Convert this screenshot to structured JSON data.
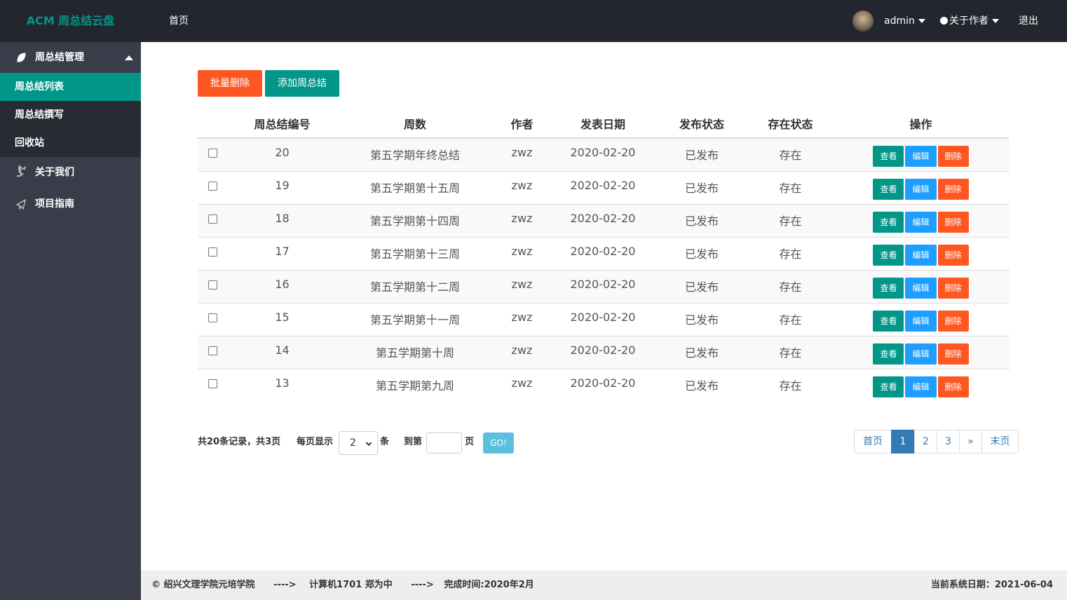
{
  "header": {
    "logo": "ACM 周总结云盘",
    "nav_home": "首页",
    "user": "admin",
    "about_author": "关于作者",
    "logout": "退出"
  },
  "sidebar": {
    "group_label": "周总结管理",
    "sub_items": [
      {
        "label": "周总结列表",
        "active": true
      },
      {
        "label": "周总结撰写",
        "active": false
      },
      {
        "label": "回收站",
        "active": false
      }
    ],
    "links": [
      {
        "label": "关于我们",
        "icon": "twitter-icon"
      },
      {
        "label": "项目指南",
        "icon": "paper-plane-icon"
      }
    ]
  },
  "toolbar": {
    "batch_delete": "批量删除",
    "add_summary": "添加周总结"
  },
  "table": {
    "headers": [
      "周总结编号",
      "周数",
      "作者",
      "发表日期",
      "发布状态",
      "存在状态",
      "操作"
    ],
    "actions": {
      "view": "查看",
      "edit": "编辑",
      "delete": "删除"
    },
    "rows": [
      {
        "id": "20",
        "week": "第五学期年终总结",
        "author": "zwz",
        "date": "2020-02-20",
        "publish": "已发布",
        "exist": "存在"
      },
      {
        "id": "19",
        "week": "第五学期第十五周",
        "author": "zwz",
        "date": "2020-02-20",
        "publish": "已发布",
        "exist": "存在"
      },
      {
        "id": "18",
        "week": "第五学期第十四周",
        "author": "zwz",
        "date": "2020-02-20",
        "publish": "已发布",
        "exist": "存在"
      },
      {
        "id": "17",
        "week": "第五学期第十三周",
        "author": "zwz",
        "date": "2020-02-20",
        "publish": "已发布",
        "exist": "存在"
      },
      {
        "id": "16",
        "week": "第五学期第十二周",
        "author": "zwz",
        "date": "2020-02-20",
        "publish": "已发布",
        "exist": "存在"
      },
      {
        "id": "15",
        "week": "第五学期第十一周",
        "author": "zwz",
        "date": "2020-02-20",
        "publish": "已发布",
        "exist": "存在"
      },
      {
        "id": "14",
        "week": "第五学期第十周",
        "author": "zwz",
        "date": "2020-02-20",
        "publish": "已发布",
        "exist": "存在"
      },
      {
        "id": "13",
        "week": "第五学期第九周",
        "author": "zwz",
        "date": "2020-02-20",
        "publish": "已发布",
        "exist": "存在"
      }
    ]
  },
  "pager": {
    "summary": "共20条记录，共3页",
    "per_page_label": "每页显示",
    "per_page_value": "2",
    "unit": "条",
    "goto_label": "到第",
    "page_unit": "页",
    "go": "GO!",
    "pages": [
      {
        "label": "首页",
        "active": false
      },
      {
        "label": "1",
        "active": true
      },
      {
        "label": "2",
        "active": false
      },
      {
        "label": "3",
        "active": false
      },
      {
        "label": "»",
        "active": false
      },
      {
        "label": "末页",
        "active": false
      }
    ]
  },
  "footer": {
    "copyright": "© 绍兴文理学院元培学院",
    "arrow": "---->",
    "author": "计算机1701 郑为中",
    "completed": "完成时间:2020年2月",
    "current_date": "当前系统日期：2021-06-04"
  },
  "colors": {
    "primary": "#009688",
    "danger": "#ff5722",
    "info": "#1e9fff",
    "header_bg": "#23262e",
    "sidebar_bg": "#393d49"
  }
}
